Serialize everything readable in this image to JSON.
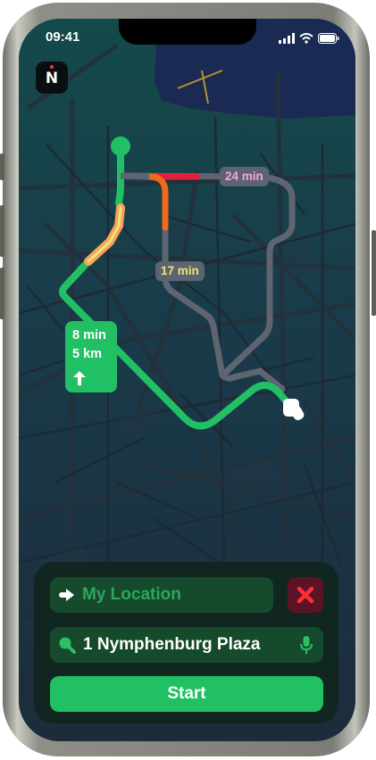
{
  "status_bar": {
    "time": "09:41",
    "icons": [
      "signal-icon",
      "wifi-icon",
      "battery-icon"
    ]
  },
  "app": {
    "logo_letter": "N"
  },
  "map": {
    "routes": [
      {
        "label": "24 min",
        "label_color": "#f7a6d6",
        "color": "#5b6470"
      },
      {
        "label": "17 min",
        "label_color": "#f2e27a",
        "color": "#5b6470"
      },
      {
        "label_time": "8 min",
        "label_distance": "5 km",
        "color": "#22c064",
        "selected": true
      }
    ],
    "traffic_colors": {
      "heavy": "#e0213c",
      "moderate": "#f06a1a",
      "light": "#f7a25a"
    }
  },
  "search_panel": {
    "origin": {
      "icon": "arrow-right-icon",
      "placeholder": "My Location"
    },
    "clear_button": {
      "icon": "close-x-icon",
      "color": "#ff2d3a"
    },
    "destination": {
      "icon": "search-icon",
      "value": "1  Nymphenburg Plaza",
      "mic_icon": "microphone-icon"
    },
    "start_label": "Start"
  },
  "colors": {
    "accent_green": "#22c064",
    "field_bg": "#154a2c",
    "panel_bg": "#122621",
    "map_bg": "#1b2d35"
  }
}
